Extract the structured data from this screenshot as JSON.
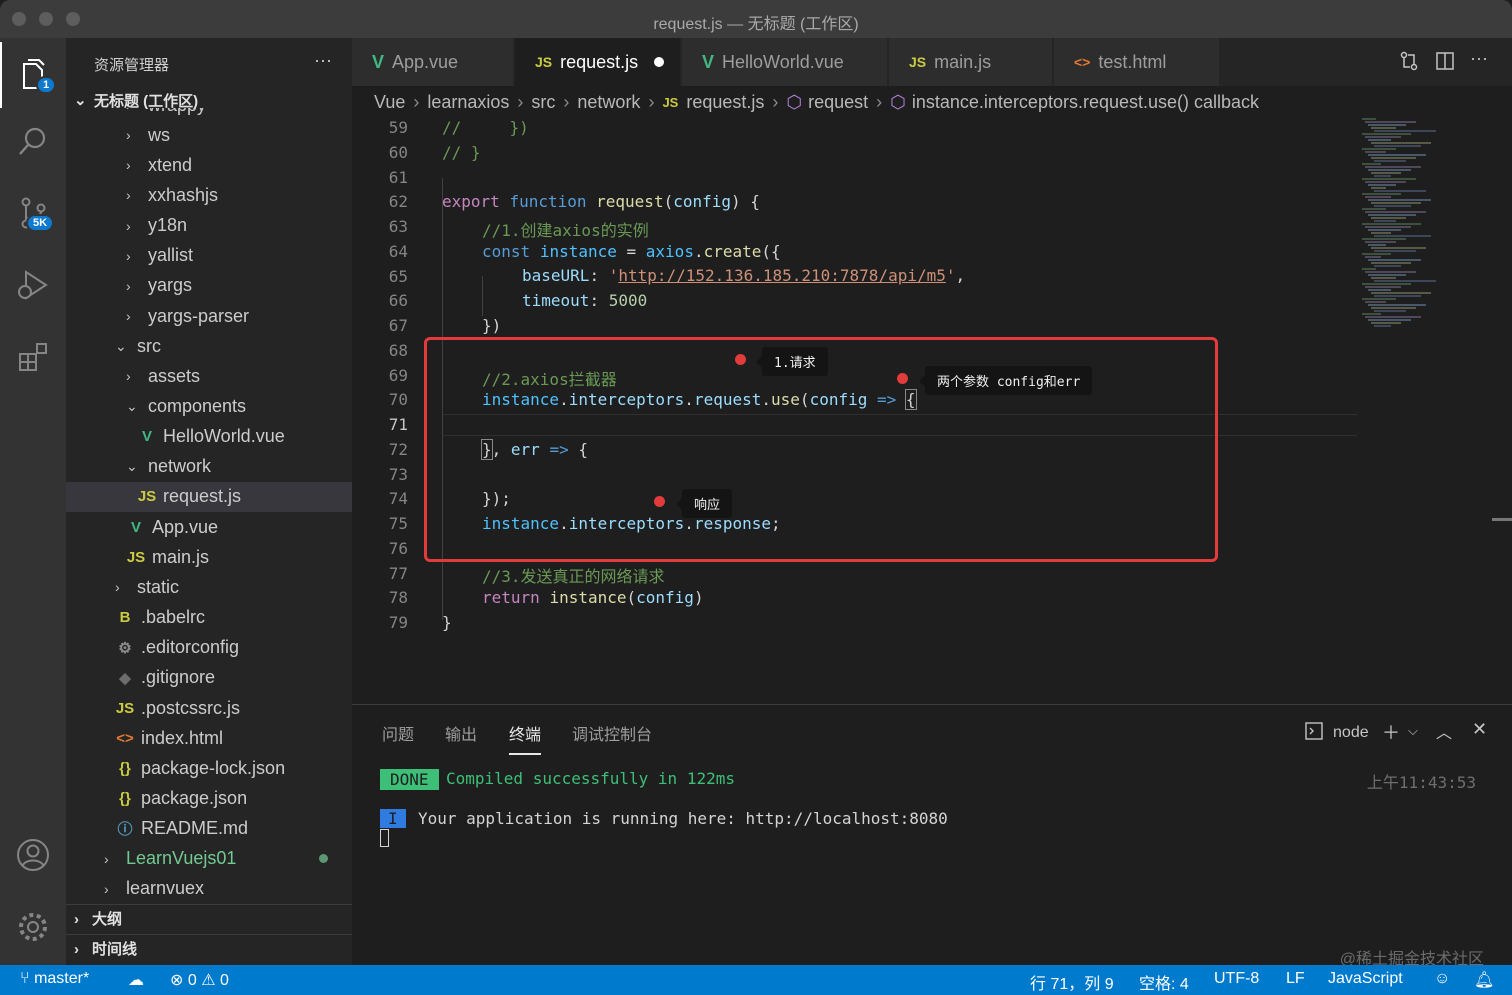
{
  "window": {
    "title": "request.js — 无标题 (工作区)"
  },
  "activity": {
    "explorer_badge": "1",
    "scm_badge": "5K"
  },
  "sidebar": {
    "title": "资源管理器",
    "more": "···",
    "workspace": "无标题 (工作区)",
    "tree": [
      {
        "label": "wrappy",
        "type": "folder",
        "open": false
      },
      {
        "label": "ws",
        "type": "folder",
        "open": false
      },
      {
        "label": "xtend",
        "type": "folder",
        "open": false
      },
      {
        "label": "xxhashjs",
        "type": "folder",
        "open": false
      },
      {
        "label": "y18n",
        "type": "folder",
        "open": false
      },
      {
        "label": "yallist",
        "type": "folder",
        "open": false
      },
      {
        "label": "yargs",
        "type": "folder",
        "open": false
      },
      {
        "label": "yargs-parser",
        "type": "folder",
        "open": false
      },
      {
        "label": "src",
        "type": "folder",
        "open": true
      },
      {
        "label": "assets",
        "type": "folder",
        "open": false
      },
      {
        "label": "components",
        "type": "folder",
        "open": true
      },
      {
        "label": "HelloWorld.vue",
        "type": "vue"
      },
      {
        "label": "network",
        "type": "folder",
        "open": true
      },
      {
        "label": "request.js",
        "type": "js",
        "selected": true
      },
      {
        "label": "App.vue",
        "type": "vue"
      },
      {
        "label": "main.js",
        "type": "js"
      },
      {
        "label": "static",
        "type": "folder",
        "open": false
      },
      {
        "label": ".babelrc",
        "type": "babel"
      },
      {
        "label": ".editorconfig",
        "type": "gear"
      },
      {
        "label": ".gitignore",
        "type": "git"
      },
      {
        "label": ".postcssrc.js",
        "type": "js"
      },
      {
        "label": "index.html",
        "type": "html"
      },
      {
        "label": "package-lock.json",
        "type": "json"
      },
      {
        "label": "package.json",
        "type": "json"
      },
      {
        "label": "README.md",
        "type": "info"
      },
      {
        "label": "LearnVuejs01",
        "type": "folder",
        "open": false,
        "modified": true
      },
      {
        "label": "learnvuex",
        "type": "folder",
        "open": false
      }
    ],
    "outline": "大纲",
    "timeline": "时间线"
  },
  "tabs": [
    {
      "label": "App.vue",
      "icon": "vue-icon",
      "active": false
    },
    {
      "label": "request.js",
      "icon": "js-icon",
      "active": true,
      "dirty": true
    },
    {
      "label": "HelloWorld.vue",
      "icon": "vue-icon",
      "active": false
    },
    {
      "label": "main.js",
      "icon": "js-icon",
      "active": false
    },
    {
      "label": "test.html",
      "icon": "html-icon",
      "active": false
    }
  ],
  "breadcrumb": [
    "Vue",
    "learnaxios",
    "src",
    "network",
    "request.js",
    "request",
    "instance.interceptors.request.use() callback"
  ],
  "editor": {
    "lines": [
      "59",
      "60",
      "61",
      "62",
      "63",
      "64",
      "65",
      "66",
      "67",
      "68",
      "69",
      "70",
      "71",
      "72",
      "73",
      "74",
      "75",
      "76",
      "77",
      "78",
      "79"
    ],
    "current_line": "71",
    "code": {
      "c59a": "//",
      "c59b": "})",
      "c60": "// }",
      "c62_kw": "export",
      "c62_fnkw": "function",
      "c62_name": "request",
      "c62_param": "config",
      "c62_end": ") {",
      "c63": "//1.创建axios的实例",
      "c64_const": "const",
      "c64_var": "instance",
      "c64_eq": " = ",
      "c64_obj": "axios",
      "c64_fn": "create",
      "c64_end": "({",
      "c65_key": "baseURL",
      "c65_url": "http://152.136.185.210:7878/api/m5",
      "c66_key": "timeout",
      "c66_val": "5000",
      "c67": "})",
      "c69": "//2.axios拦截器",
      "c70_a": "instance",
      "c70_b": "interceptors",
      "c70_c": "request",
      "c70_d": "use",
      "c70_param": "config",
      "c70_arrow": "=>",
      "c70_brace": "{",
      "c72_brace": "}",
      "c72_err": "err",
      "c72_arrow": "=>",
      "c72_end": "{",
      "c74": "});",
      "c75_a": "instance",
      "c75_b": "interceptors",
      "c75_c": "response",
      "c77": "//3.发送真正的网络请求",
      "c78_kw": "return",
      "c78_fn": "instance",
      "c78_param": "config",
      "c79": "}"
    },
    "notes": {
      "request": "1.请求",
      "params": "两个参数 config和err",
      "response": "响应"
    }
  },
  "panel": {
    "tabs": [
      "问题",
      "输出",
      "终端",
      "调试控制台"
    ],
    "active_tab": "终端",
    "terminal_name": "node",
    "done": "DONE",
    "compiled": "Compiled successfully in 122ms",
    "time": "上午11:43:53",
    "info_tag": "I",
    "running": "Your application is running here: http://localhost:8080",
    "watermark": "@稀土掘金技术社区"
  },
  "status": {
    "branch": "master*",
    "errors": "0",
    "warnings": "0",
    "position": "行 71，列 9",
    "spaces": "空格: 4",
    "encoding": "UTF-8",
    "eol": "LF",
    "language": "JavaScript"
  },
  "colors": {
    "accent": "#007acc",
    "annotation_red": "#e23b3b",
    "done_green": "#3dbf78"
  }
}
